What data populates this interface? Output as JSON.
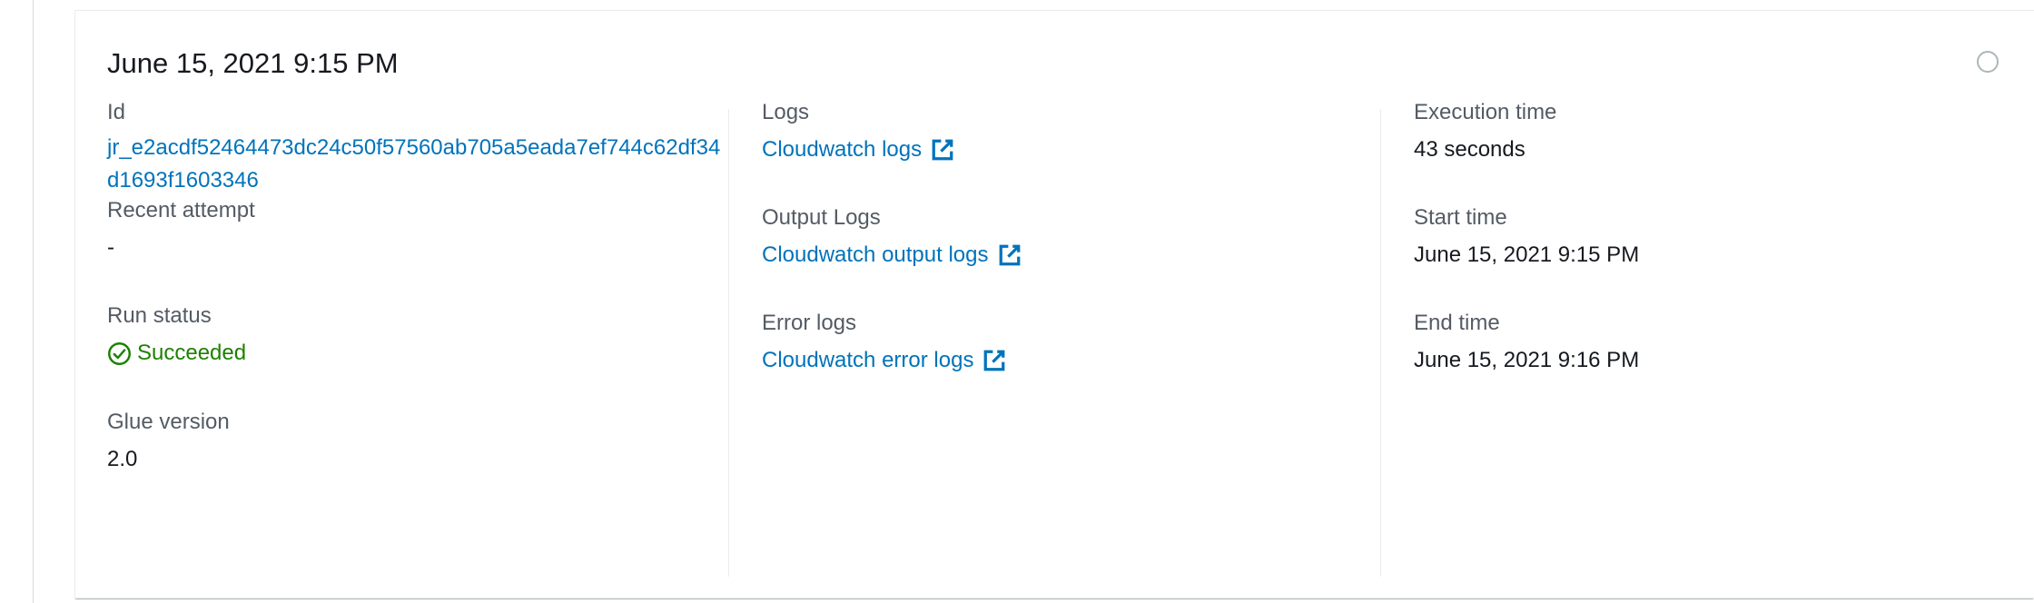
{
  "run": {
    "title": "June 15, 2021 9:15 PM"
  },
  "details": {
    "id": {
      "label": "Id",
      "value": "jr_e2acdf52464473dc24c50f57560ab705a5eada7ef744c62df34d1693f1603346"
    },
    "recent_attempt": {
      "label": "Recent attempt",
      "value": "-"
    },
    "run_status": {
      "label": "Run status",
      "value": "Succeeded",
      "icon": "check-circle-icon",
      "color": "#1d8102"
    },
    "glue_version": {
      "label": "Glue version",
      "value": "2.0"
    },
    "logs": {
      "label": "Logs",
      "link_text": "Cloudwatch logs",
      "icon": "external-link-icon"
    },
    "output_logs": {
      "label": "Output Logs",
      "link_text": "Cloudwatch output logs",
      "icon": "external-link-icon"
    },
    "error_logs": {
      "label": "Error logs",
      "link_text": "Cloudwatch error logs",
      "icon": "external-link-icon"
    },
    "execution_time": {
      "label": "Execution time",
      "value": "43 seconds"
    },
    "start_time": {
      "label": "Start time",
      "value": "June 15, 2021 9:15 PM"
    },
    "end_time": {
      "label": "End time",
      "value": "June 15, 2021 9:16 PM"
    }
  },
  "colors": {
    "link": "#0073bb",
    "label": "#545b64",
    "text": "#16191f",
    "success": "#1d8102"
  }
}
